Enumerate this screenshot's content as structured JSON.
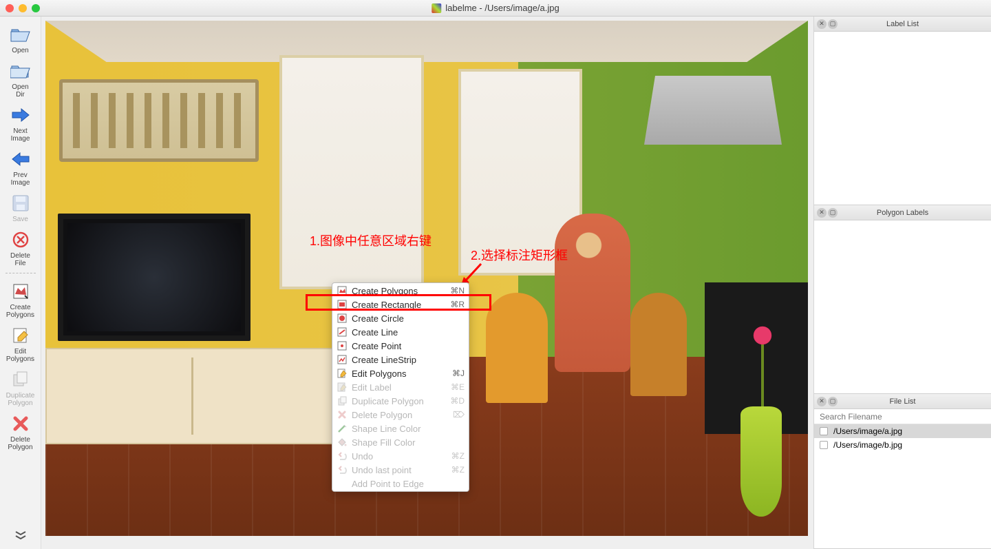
{
  "titlebar": {
    "app_name": "labelme",
    "file_path": "/Users/image/a.jpg",
    "title": "labelme - /Users/image/a.jpg"
  },
  "toolbar": {
    "open": "Open",
    "open_dir": "Open\nDir",
    "next_image": "Next\nImage",
    "prev_image": "Prev\nImage",
    "save": "Save",
    "delete_file": "Delete\nFile",
    "create_polygons": "Create\nPolygons",
    "edit_polygons": "Edit\nPolygons",
    "duplicate_polygon": "Duplicate\nPolygon",
    "delete_polygon": "Delete\nPolygon"
  },
  "annotations": {
    "annot1": "1.图像中任意区域右键",
    "annot2": "2.选择标注矩形框"
  },
  "context_menu": {
    "items": [
      {
        "label": "Create Polygons",
        "shortcut": "⌘N",
        "icon": "polygon-icon",
        "enabled": true
      },
      {
        "label": "Create Rectangle",
        "shortcut": "⌘R",
        "icon": "rectangle-icon",
        "enabled": true,
        "highlighted": true
      },
      {
        "label": "Create Circle",
        "shortcut": "",
        "icon": "circle-icon",
        "enabled": true
      },
      {
        "label": "Create Line",
        "shortcut": "",
        "icon": "line-icon",
        "enabled": true
      },
      {
        "label": "Create Point",
        "shortcut": "",
        "icon": "point-icon",
        "enabled": true
      },
      {
        "label": "Create LineStrip",
        "shortcut": "",
        "icon": "linestrip-icon",
        "enabled": true
      },
      {
        "label": "Edit Polygons",
        "shortcut": "⌘J",
        "icon": "edit-icon",
        "enabled": true
      },
      {
        "label": "Edit Label",
        "shortcut": "⌘E",
        "icon": "edit-label-icon",
        "enabled": false
      },
      {
        "label": "Duplicate Polygon",
        "shortcut": "⌘D",
        "icon": "duplicate-icon",
        "enabled": false
      },
      {
        "label": "Delete Polygon",
        "shortcut": "⌦",
        "icon": "delete-icon",
        "enabled": false
      },
      {
        "label": "Shape Line Color",
        "shortcut": "",
        "icon": "line-color-icon",
        "enabled": false
      },
      {
        "label": "Shape Fill Color",
        "shortcut": "",
        "icon": "fill-color-icon",
        "enabled": false
      },
      {
        "label": "Undo",
        "shortcut": "⌘Z",
        "icon": "undo-icon",
        "enabled": false
      },
      {
        "label": "Undo last point",
        "shortcut": "⌘Z",
        "icon": "undo-point-icon",
        "enabled": false
      },
      {
        "label": "Add Point to Edge",
        "shortcut": "",
        "icon": "add-point-icon",
        "enabled": false
      }
    ]
  },
  "panels": {
    "label_list": {
      "title": "Label List"
    },
    "polygon_labels": {
      "title": "Polygon Labels"
    },
    "file_list": {
      "title": "File List",
      "search_placeholder": "Search Filename",
      "files": [
        {
          "path": "/Users/image/a.jpg",
          "selected": true,
          "checked": false
        },
        {
          "path": "/Users/image/b.jpg",
          "selected": false,
          "checked": false
        }
      ]
    }
  },
  "colors": {
    "highlight": "#ff0000"
  }
}
